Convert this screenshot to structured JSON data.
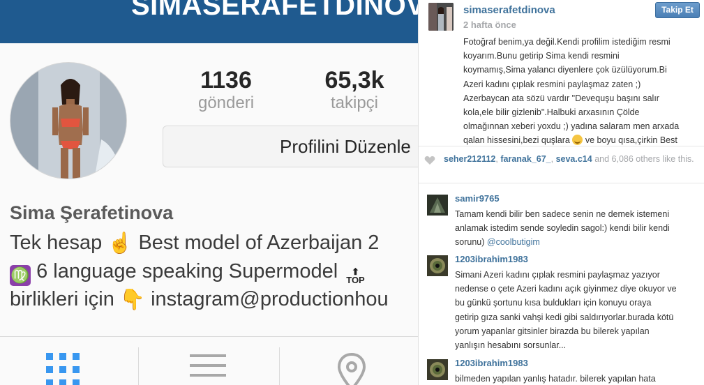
{
  "profile": {
    "top_username": "SIMASERAFETDINOVA",
    "stats": {
      "posts_value": "1136",
      "posts_label": "gönderi",
      "followers_value": "65,3k",
      "followers_label": "takipçi"
    },
    "edit_button_label": "Profilini Düzenle",
    "full_name": "Sima Şerafetinova",
    "bio": {
      "line1_a": "Tek hesap",
      "line1_emoji": "☝",
      "line1_b": "Best model of Azerbaijan 2",
      "line2_virgo": "♍",
      "line2_text": "6 language speaking Supermodel",
      "line2_top_badge": "TOP",
      "line3_a": "birlikleri için",
      "line3_emoji": "👇",
      "line3_b": "instagram@productionhou"
    },
    "icons": [
      "grid-icon",
      "list-icon",
      "location-pin-icon"
    ]
  },
  "post": {
    "username": "simaserafetdinova",
    "time": "2 hafta önce",
    "follow_label": "Takip Et",
    "caption_lines": [
      "Fotoğraf benim,ya değil.Kendi profilim istediğim resmi",
      "koyarım.Bunu getirip Sima kendi resmini",
      "koymamış,Sima yalancı diyenlere çok üzülüyorum.Bi",
      "Azeri kadını çıplak resmini paylaşmaz zaten ;)",
      "Azerbaycan ata sözü vardır \"Devequşu başını salır",
      "kola,ele bilir gizlenib\".Halbuki arxasının Çölde",
      "olmağınnan xeberi yoxdu ;) yadına salaram men arxada"
    ],
    "caption_last_a": "qalan hissesini,bezi quşlara",
    "caption_last_b": "ve boyu qısa,çirkin Best",
    "likes": {
      "user1": "seher212112",
      "user2": "faranak_67_",
      "user3": "seva.c14",
      "rest": "and 6,086 others like this."
    },
    "comments": [
      {
        "user": "samir9765",
        "lines": [
          "Tamam kendi bilir ben sadece senin ne demek istemeni",
          "anlamak istedim sende soyledin sagol:) kendi bilir kendi"
        ],
        "last_line_a": "sorunu)",
        "last_line_mention": "@coolbutigim"
      },
      {
        "user": "1203ibrahim1983",
        "lines": [
          "Simani Azeri kadını çıplak resmini paylaşmaz yazıyor",
          "nedense o çete Azeri kadını açık giyinmez diye okuyor ve",
          "bu günkü şortunu kısa buldukları için konuyu oraya",
          "getirip gıza sanki vahşi kedi gibi saldırıyorlar.burada kötü",
          "yorum yapanlar gitsinler birazda bu bilerek yapılan",
          "yanlışın hesabını sorsunlar..."
        ]
      },
      {
        "user": "1203ibrahim1983",
        "lines": [
          "bilmeden yapılan yanlış hatadır. bilerek yapılan hata"
        ]
      }
    ]
  },
  "colors": {
    "header_blue": "#1f5a8f",
    "link_blue": "#3f729b",
    "muted_gray": "#a5a7aa",
    "grid_blue": "#3897f0"
  }
}
